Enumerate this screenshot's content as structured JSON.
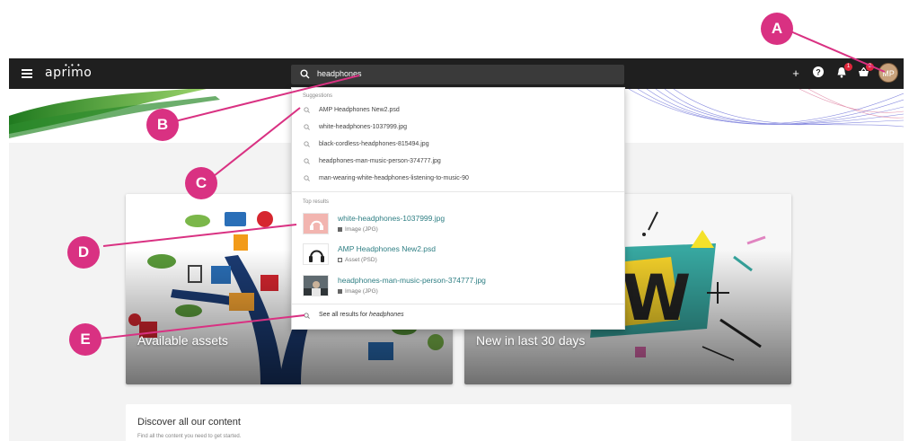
{
  "app": {
    "logo": "aprimo"
  },
  "search": {
    "value": "headphones",
    "icon": "search-icon"
  },
  "topbar": {
    "add_icon": "+",
    "help_icon": "?",
    "notifications_count": "1",
    "basket_count": "3",
    "avatar_initials": "MP"
  },
  "dropdown": {
    "suggestions_label": "Suggestions",
    "suggestions": [
      "AMP Headphones New2.psd",
      "white-headphones-1037999.jpg",
      "black-cordless-headphones-815494.jpg",
      "headphones-man-music-person-374777.jpg",
      "man-wearing-white-headphones-listening-to-music-90"
    ],
    "top_results_label": "Top results",
    "results": [
      {
        "name": "white-headphones-1037999.jpg",
        "type": "Image (JPG)"
      },
      {
        "name": "AMP Headphones New2.psd",
        "type": "Asset (PSD)"
      },
      {
        "name": "headphones-man-music-person-374777.jpg",
        "type": "Image (JPG)"
      }
    ],
    "see_all_prefix": "See all results for",
    "see_all_term": "headphones"
  },
  "cards": {
    "assets_title": "Available assets",
    "new_title": "New in last 30 days"
  },
  "discover": {
    "heading": "Discover all our content",
    "subtext": "Find all the content you need to get started."
  },
  "callouts": {
    "a": "A",
    "b": "B",
    "c": "C",
    "d": "D",
    "e": "E"
  },
  "colors": {
    "callout": "#d93182",
    "topbar": "#1f1f1f",
    "result_link": "#2f7f84"
  }
}
